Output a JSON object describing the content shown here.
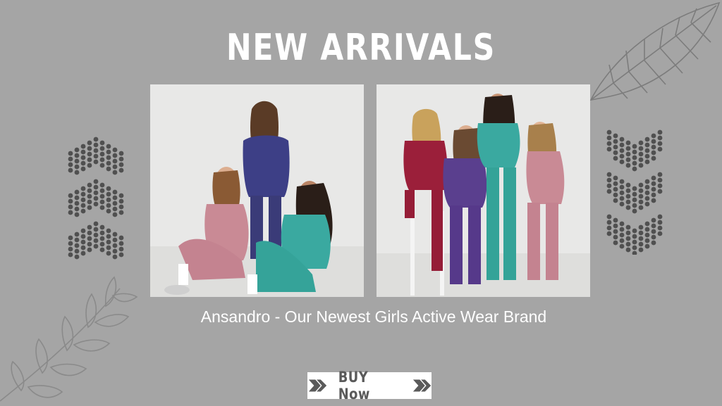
{
  "banner": {
    "title": "NEW ARRIVALS",
    "caption": "Ansandro - Our Newest Girls Active Wear Brand",
    "button_label": "BUY Now"
  },
  "images": [
    {
      "alt": "Three girls in pink, navy and teal active wear"
    },
    {
      "alt": "Four girls in burgundy, purple, teal and pink active wear"
    }
  ],
  "decorations": {
    "leaf_top_right": "leaf-icon",
    "leaf_bottom_left": "branch-icon",
    "chevrons_left": "dotted-chevron-up-icon",
    "chevrons_right": "dotted-chevron-down-icon",
    "arrows": "double-chevron-right-icon"
  },
  "colors": {
    "background": "#a5a5a5",
    "text": "#ffffff",
    "button_text": "#5a5a5a"
  }
}
